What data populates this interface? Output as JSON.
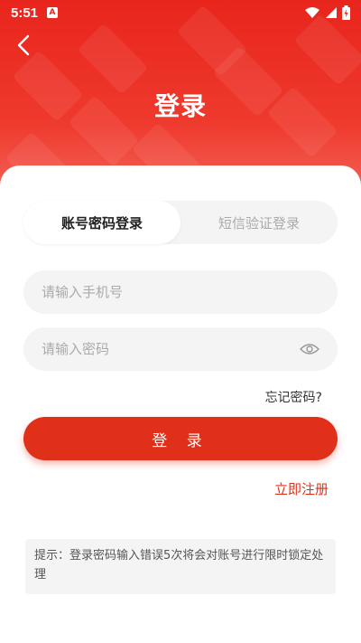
{
  "status_bar": {
    "time": "5:51",
    "notification_letter": "A"
  },
  "header": {
    "title": "登录"
  },
  "tabs": [
    {
      "label": "账号密码登录",
      "active": true
    },
    {
      "label": "短信验证登录",
      "active": false
    }
  ],
  "form": {
    "phone_placeholder": "请输入手机号",
    "password_placeholder": "请输入密码",
    "forgot_password": "忘记密码?",
    "login_button": "登 录",
    "register_link": "立即注册"
  },
  "tip": {
    "text": "提示：登录密码输入错误5次将会对账号进行限时锁定处理"
  },
  "colors": {
    "brand_red": "#e0301a",
    "header_red": "#e8251c"
  },
  "icons": [
    "back-arrow-icon",
    "wifi-icon",
    "signal-icon",
    "battery-icon",
    "eye-icon"
  ]
}
